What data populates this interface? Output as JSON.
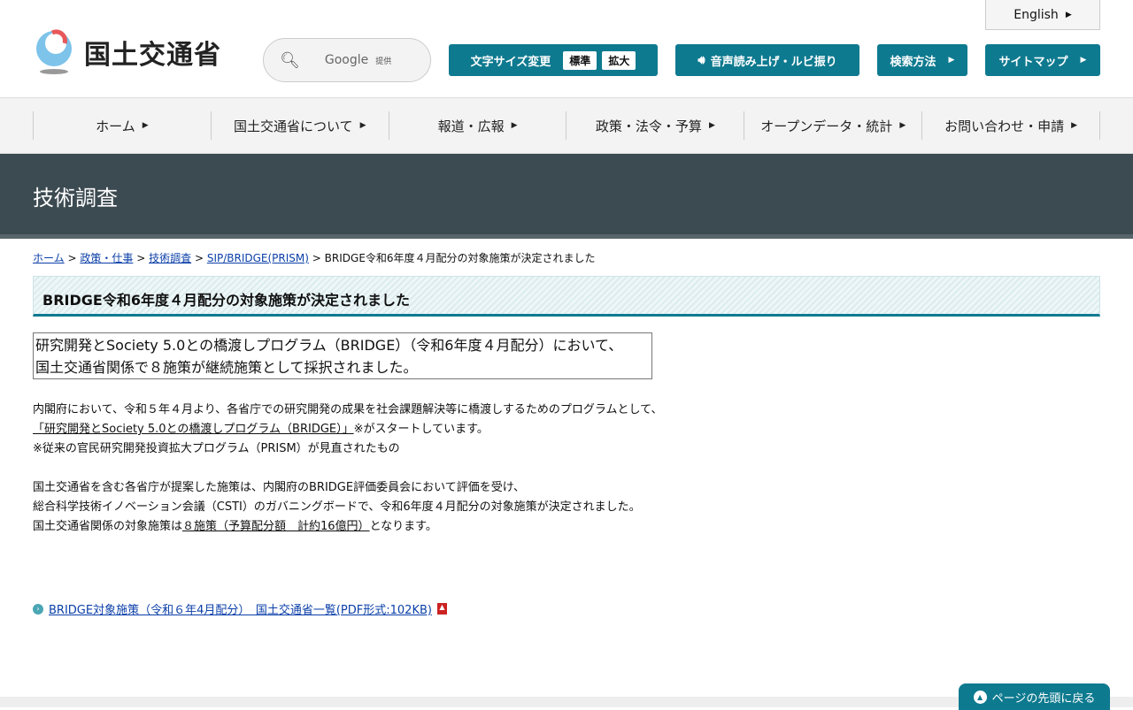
{
  "header": {
    "logo_text": "国土交通省",
    "search_brand": "Google",
    "search_provided": "提供",
    "font_size_label": "文字サイズ変更",
    "font_standard": "標準",
    "font_large": "拡大",
    "read_aloud": "音声読み上げ・ルビ振り",
    "search_method": "検索方法",
    "sitemap": "サイトマップ",
    "english": "English"
  },
  "nav": [
    "ホーム",
    "国土交通省について",
    "報道・広報",
    "政策・法令・予算",
    "オープンデータ・統計",
    "お問い合わせ・申請"
  ],
  "banner": "技術調査",
  "breadcrumb": {
    "items": [
      "ホーム",
      "政策・仕事",
      "技術調査",
      "SIP/BRIDGE(PRISM)"
    ],
    "current": "BRIDGE令和6年度４月配分の対象施策が決定されました",
    "sep": ">"
  },
  "title": "BRIDGE令和6年度４月配分の対象施策が決定されました",
  "box": [
    "研究開発とSociety 5.0との橋渡しプログラム（BRIDGE）（令和6年度４月配分）において、",
    "国土交通省関係で８施策が継続施策として採択されました。"
  ],
  "p1": {
    "line1": "内閣府において、令和５年４月より、各省庁での研究開発の成果を社会課題解決等に橋渡しするためのプログラムとして、",
    "link": "「研究開発とSociety 5.0との橋渡しプログラム（BRIDGE）」",
    "line2_rest": "※がスタートしています。",
    "line3": "※従来の官民研究開発投資拡大プログラム（PRISM）が見直されたもの"
  },
  "p2": {
    "line1": "国土交通省を含む各省庁が提案した施策は、内閣府のBRIDGE評価委員会において評価を受け、",
    "line2": "総合科学技術イノベーション会議（CSTI）のガバニングボードで、令和6年度４月配分の対象施策が決定されました。",
    "line3_pre": "国土交通省関係の対象施策は",
    "line3_link": "８施策（予算配分額　計約16億円）",
    "line3_post": "となります。"
  },
  "pdf_link": "BRIDGE対象施策（令和６年4月配分）　国土交通省一覧(PDF形式:102KB)",
  "back_to_top": "ページの先頭に戻る"
}
